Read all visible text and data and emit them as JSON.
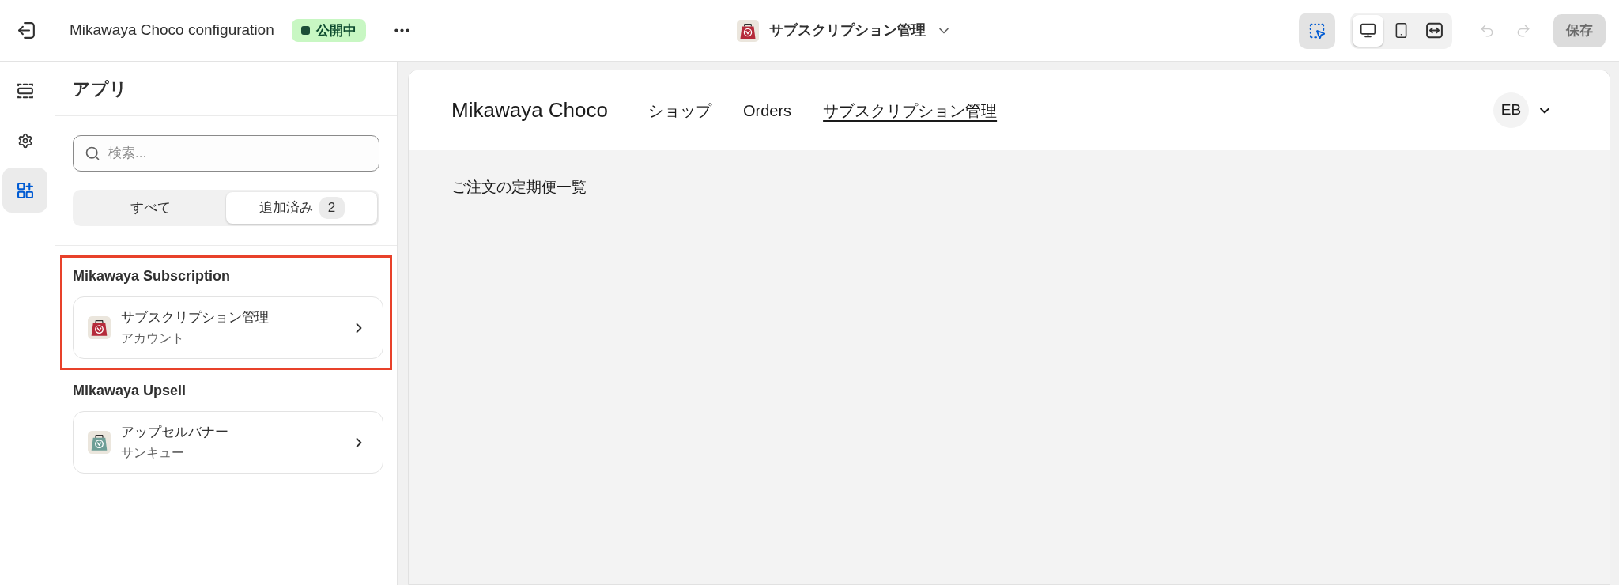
{
  "top_bar": {
    "title": "Mikawaya Choco configuration",
    "status_badge": {
      "label": "公開中"
    },
    "page_selector": {
      "label": "サブスクリプション管理"
    },
    "inspector_button": {
      "on": true
    },
    "view_modes": [
      {
        "kind": "desktop",
        "selected": true
      },
      {
        "kind": "mobile",
        "selected": false
      },
      {
        "kind": "full_width",
        "selected": false
      }
    ],
    "history": [
      {
        "kind": "undo",
        "disabled": true
      },
      {
        "kind": "redo",
        "disabled": true
      }
    ],
    "save_button": {
      "label": "保存",
      "disabled": true
    }
  },
  "rail": [
    {
      "kind": "sections",
      "selected": false
    },
    {
      "kind": "settings",
      "selected": false
    },
    {
      "kind": "apps",
      "selected": true
    }
  ],
  "panel": {
    "title": "アプリ",
    "search": {
      "placeholder": "検索..."
    },
    "filter_tabs": [
      {
        "label": "すべて",
        "selected": false
      },
      {
        "label": "追加済み",
        "count": "2",
        "selected": true
      }
    ],
    "app_groups": [
      {
        "name": "Mikawaya Subscription",
        "highlighted": true,
        "blocks": [
          {
            "title": "サブスクリプション管理",
            "subtitle": "アカウント",
            "color": "#b52b3a"
          }
        ]
      },
      {
        "name": "Mikawaya Upsell",
        "highlighted": false,
        "blocks": [
          {
            "title": "アップセルバナー",
            "subtitle": "サンキュー",
            "color": "#6e9e96"
          }
        ]
      }
    ]
  },
  "preview": {
    "store_name": "Mikawaya Choco",
    "nav": [
      {
        "label": "ショップ",
        "selected": false
      },
      {
        "label": "Orders",
        "selected": false
      },
      {
        "label": "サブスクリプション管理",
        "selected": true
      }
    ],
    "account": {
      "initials": "EB"
    },
    "heading": "ご注文の定期便一覧"
  }
}
